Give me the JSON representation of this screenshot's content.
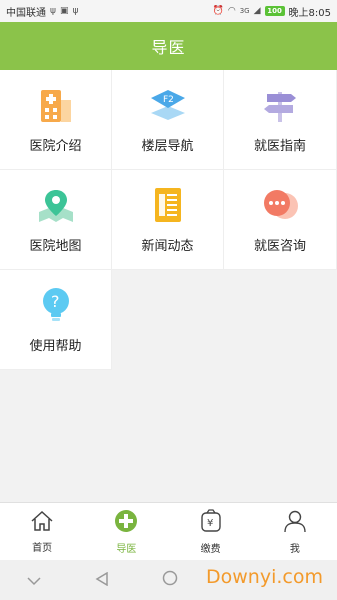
{
  "status_bar": {
    "carrier": "中国联通",
    "time": "晚上8:05",
    "battery": "100",
    "network": "3G"
  },
  "header": {
    "title": "导医"
  },
  "menu": {
    "items": [
      {
        "label": "医院介绍",
        "icon": "hospital-building-icon"
      },
      {
        "label": "楼层导航",
        "icon": "floor-layers-icon"
      },
      {
        "label": "就医指南",
        "icon": "signpost-icon"
      },
      {
        "label": "医院地图",
        "icon": "map-pin-icon"
      },
      {
        "label": "新闻动态",
        "icon": "news-document-icon"
      },
      {
        "label": "就医咨询",
        "icon": "chat-bubble-icon"
      },
      {
        "label": "使用帮助",
        "icon": "help-lightbulb-icon"
      }
    ],
    "floor_icon_text": "F2"
  },
  "tab_bar": {
    "tabs": [
      {
        "label": "首页",
        "icon": "home-icon",
        "active": false
      },
      {
        "label": "导医",
        "icon": "plus-circle-icon",
        "active": true
      },
      {
        "label": "缴费",
        "icon": "payment-bag-icon",
        "active": false
      },
      {
        "label": "我",
        "icon": "user-icon",
        "active": false
      }
    ],
    "payment_symbol": "¥"
  },
  "watermark": "Downyi.com",
  "colors": {
    "brand_green": "#8bc34a",
    "active_tab": "#7ab43f"
  }
}
